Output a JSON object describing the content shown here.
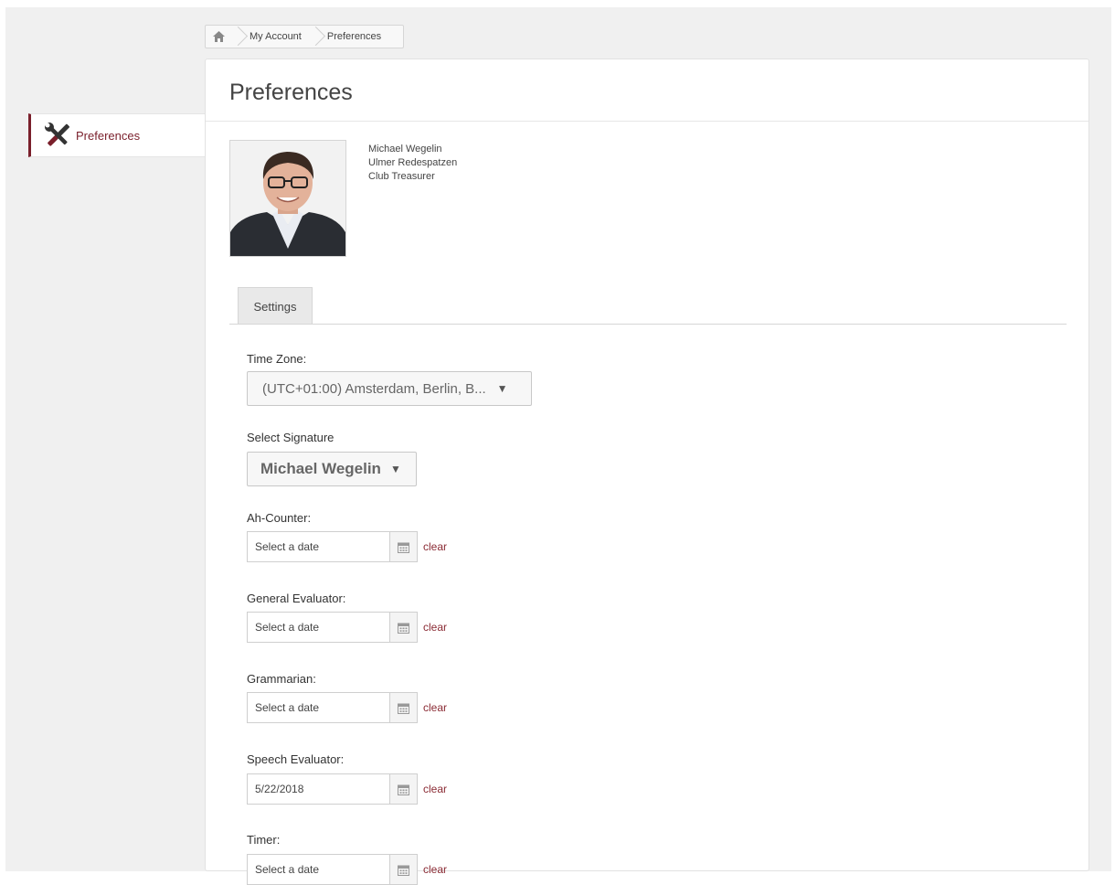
{
  "breadcrumb": {
    "items": [
      "My Account",
      "Preferences"
    ]
  },
  "sidebar": {
    "items": [
      {
        "label": "Preferences",
        "icon": "tools-icon"
      }
    ]
  },
  "page": {
    "title": "Preferences"
  },
  "profile": {
    "name": "Michael Wegelin",
    "club": "Ulmer Redespatzen",
    "role": "Club Treasurer"
  },
  "tabs": [
    {
      "label": "Settings",
      "active": true
    }
  ],
  "settings": {
    "time_zone": {
      "label": "Time Zone:",
      "value": "(UTC+01:00) Amsterdam, Berlin, B..."
    },
    "signature": {
      "label": "Select Signature",
      "value": "Michael Wegelin"
    },
    "date_fields": [
      {
        "label": "Ah-Counter:",
        "value": "",
        "placeholder": "Select a date",
        "clear_label": "clear"
      },
      {
        "label": "General Evaluator:",
        "value": "",
        "placeholder": "Select a date",
        "clear_label": "clear"
      },
      {
        "label": "Grammarian:",
        "value": "",
        "placeholder": "Select a date",
        "clear_label": "clear"
      },
      {
        "label": "Speech Evaluator:",
        "value": "5/22/2018",
        "placeholder": "Select a date",
        "clear_label": "clear"
      },
      {
        "label": "Timer:",
        "value": "",
        "placeholder": "Select a date",
        "clear_label": "clear"
      }
    ]
  },
  "colors": {
    "accent": "#7a1f2b",
    "link": "#8a2a33",
    "background": "#f0f0f0"
  }
}
